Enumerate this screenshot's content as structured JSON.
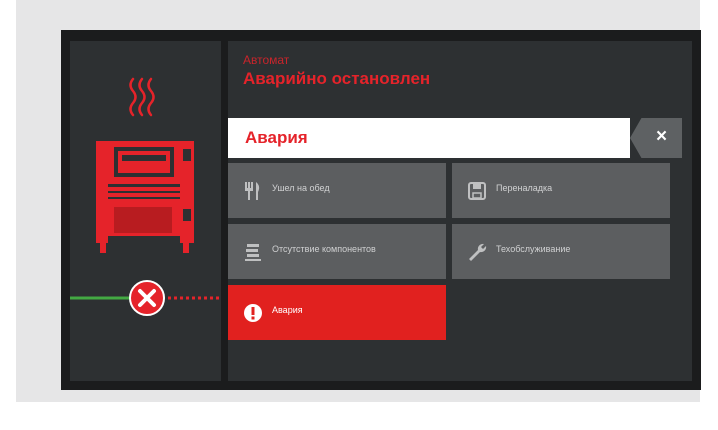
{
  "status": {
    "mode": "Автомат",
    "state": "Аварийно остановлен"
  },
  "alarm_bar": {
    "label": "Авария",
    "close": "×"
  },
  "tiles": [
    {
      "label": "Ушел на обед",
      "icon": "fork-knife-icon"
    },
    {
      "label": "Переналадка",
      "icon": "floppy-disk-icon"
    },
    {
      "label": "Отсутствие компонентов",
      "icon": "component-reel-icon"
    },
    {
      "label": "Техобслуживание",
      "icon": "wrench-icon"
    },
    {
      "label": "Авария",
      "icon": "alert-exclamation-icon",
      "active": true
    }
  ],
  "colors": {
    "accent": "#e5232a",
    "tile_bg": "#5c5e60",
    "panel_bg": "#2d3032",
    "connection_ok": "#43a943"
  }
}
